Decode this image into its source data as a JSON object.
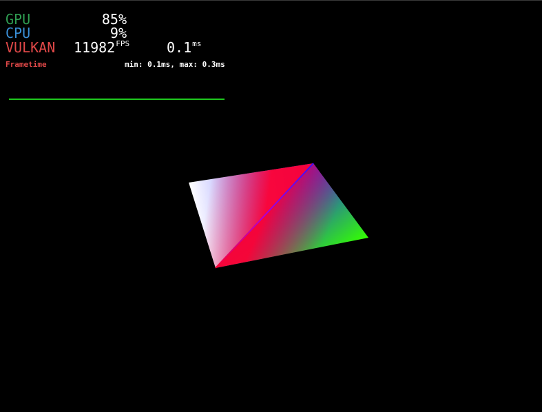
{
  "hud": {
    "gpu": {
      "label": "GPU",
      "value": "85%"
    },
    "cpu": {
      "label": "CPU",
      "value": "9%"
    },
    "api": {
      "label": "VULKAN",
      "fps_value": "11982",
      "fps_unit": "FPS",
      "frametime_value": "0.1",
      "frametime_unit": "ms"
    },
    "frametime": {
      "label": "Frametime",
      "stats": "min: 0.1ms, max: 0.3ms"
    }
  },
  "colors": {
    "background": "#000000",
    "gpu": "#2f9e52",
    "cpu": "#3a8fd6",
    "vulkan": "#e04848",
    "graph": "#1ec81e",
    "vertex_colors": [
      "#ffffff",
      "#2222ff",
      "#33ff00",
      "#ff0033"
    ]
  }
}
